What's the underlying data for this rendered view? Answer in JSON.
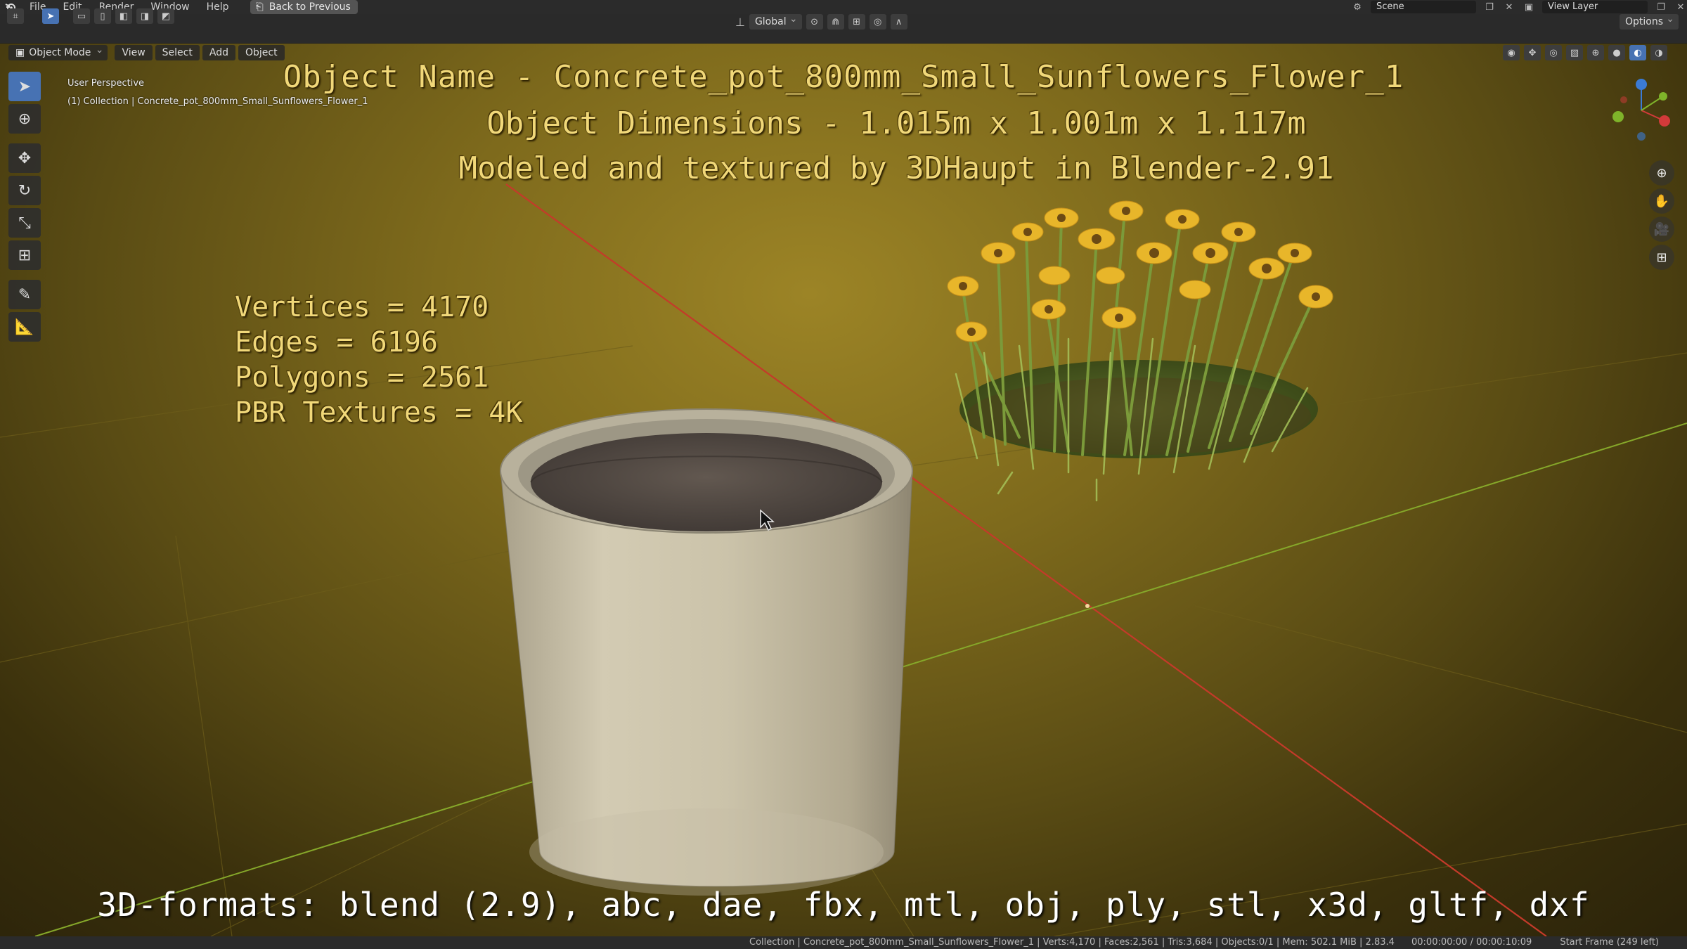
{
  "menubar": {
    "items": [
      "File",
      "Edit",
      "Render",
      "Window",
      "Help"
    ],
    "back_button": "Back to Previous",
    "scene_label": "Scene",
    "view_layer_label": "View Layer"
  },
  "tool_header": {
    "transform_orientation": "Global",
    "options_label": "Options"
  },
  "viewport_header": {
    "mode": "Object Mode",
    "menus": [
      "View",
      "Select",
      "Add",
      "Object"
    ]
  },
  "viewport_info": {
    "perspective": "User Perspective",
    "collection": "(1) Collection | Concrete_pot_800mm_Small_Sunflowers_Flower_1"
  },
  "overlay": {
    "title": "Object Name - Concrete_pot_800mm_Small_Sunflowers_Flower_1",
    "dimensions": "Object Dimensions -  1.015m x 1.001m x 1.117m",
    "modeled": "Modeled and textured by 3DHaupt in Blender-2.91",
    "stats": [
      "Vertices = 4170",
      "Edges = 6196",
      "Polygons = 2561",
      "PBR Textures = 4K"
    ],
    "formats": "3D-formats: blend (2.9), abc, dae, fbx, mtl, obj, ply, stl, x3d, gltf, dxf"
  },
  "statusbar": {
    "scene_stats": "Collection | Concrete_pot_800mm_Small_Sunflowers_Flower_1 | Verts:4,170 | Faces:2,561 | Tris:3,684 | Objects:0/1 | Mem: 502.1 MiB | 2.83.4",
    "time": "00:00:00:00 / 00:00:10:09",
    "start_frame": "Start Frame (249 left)"
  },
  "colors": {
    "accent": "#4772b3",
    "overlay_text": "#f1d879",
    "x_axis": "#d23a3a",
    "y_axis": "#7fb32a"
  }
}
